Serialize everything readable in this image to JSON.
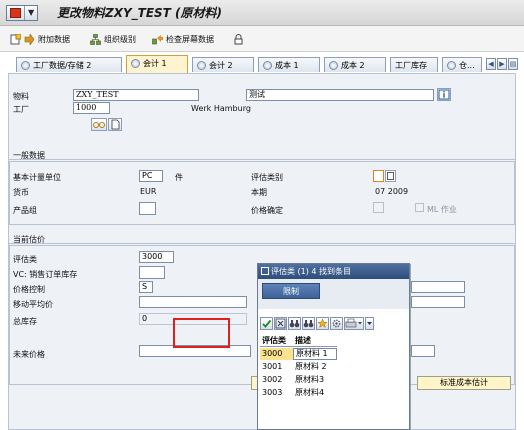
{
  "window": {
    "title": "更改物料ZXY_TEST (原材料)"
  },
  "toolbar": {
    "additional_data": "附加数据",
    "org_levels": "组织级别",
    "check_screen_data": "检查屏幕数据"
  },
  "tabs": [
    {
      "label": "工厂数据/存储 2"
    },
    {
      "label": "会计 1"
    },
    {
      "label": "会计 2"
    },
    {
      "label": "成本 1"
    },
    {
      "label": "成本 2"
    },
    {
      "label": "工厂库存"
    },
    {
      "label": "仓..."
    }
  ],
  "header": {
    "material_label": "物料",
    "material_value": "ZXY_TEST",
    "description_value": "测试",
    "plant_label": "工厂",
    "plant_value": "1000",
    "plant_name": "Werk Hamburg"
  },
  "general": {
    "section_title": "一般数据",
    "base_uom_label": "基本计量单位",
    "base_uom_value": "PC",
    "base_uom_text": "件",
    "valuation_category_label": "评估类别",
    "currency_label": "货币",
    "currency_value": "EUR",
    "current_period_label": "本期",
    "current_period_value": "07 2009",
    "division_label": "产品组",
    "price_determination_label": "价格确定",
    "ml_active_label": "ML 作业"
  },
  "valuation": {
    "section_title": "当前估价",
    "valuation_class_label": "评估类",
    "valuation_class_value": "3000",
    "vc_sales_label": "VC: 销售订单库存",
    "price_control_label": "价格控制",
    "price_control_value": "S",
    "moving_avg_label": "移动平均价",
    "total_stock_label": "总库存",
    "total_stock_value": "0",
    "future_price_label": "未来价格",
    "std_cost_button": "标准成本估计"
  },
  "popup": {
    "title": "评估类 (1)   4 找到条目",
    "tab_label": "限制",
    "col_class": "评估类",
    "col_desc": "描述",
    "rows": [
      {
        "code": "3000",
        "desc": "原材料 1"
      },
      {
        "code": "3001",
        "desc": "原材料 2"
      },
      {
        "code": "3002",
        "desc": "原材料3"
      },
      {
        "code": "3003",
        "desc": "原材料4"
      }
    ]
  },
  "colors": {
    "tab_active": "#fff3d0",
    "popup_title_bar": "#3a5a8c",
    "highlight_box": "#e0201a",
    "selected_row": "#fbe28f"
  }
}
